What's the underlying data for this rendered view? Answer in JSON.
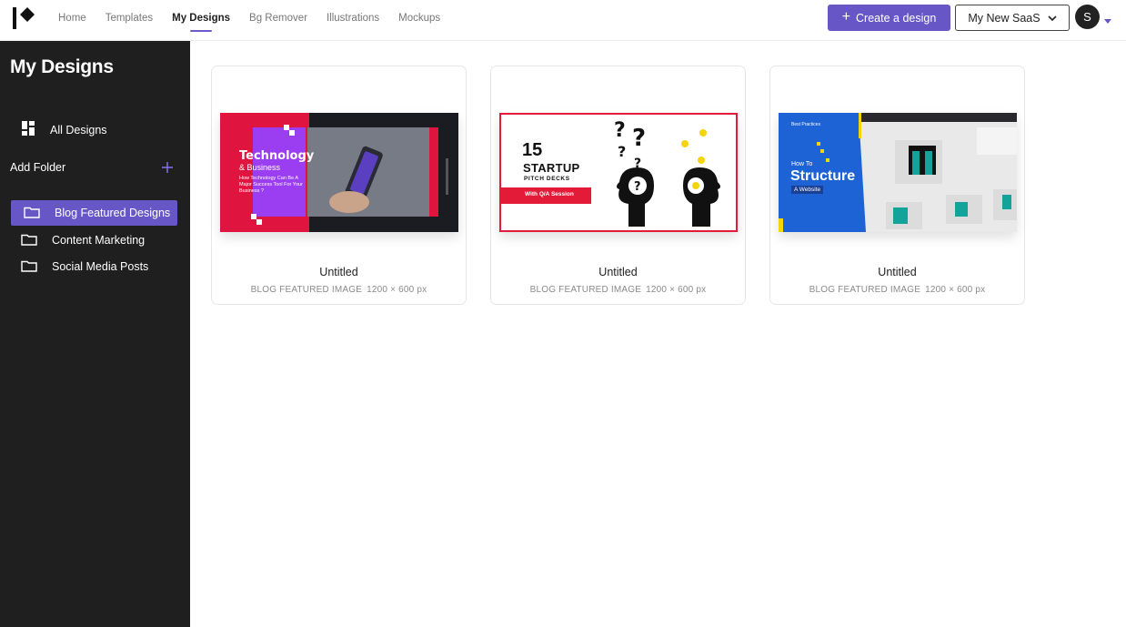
{
  "topbar": {
    "nav": [
      {
        "label": "Home",
        "active": false
      },
      {
        "label": "Templates",
        "active": false
      },
      {
        "label": "My Designs",
        "active": true
      },
      {
        "label": "Bg Remover",
        "active": false
      },
      {
        "label": "Illustrations",
        "active": false
      },
      {
        "label": "Mockups",
        "active": false
      }
    ],
    "create_label": "Create a design",
    "workspace_label": "My New SaaS",
    "avatar_initial": "S"
  },
  "sidebar": {
    "title": "My Designs",
    "all_designs_label": "All Designs",
    "add_folder_label": "Add Folder",
    "folders": [
      {
        "label": "Blog Featured Designs",
        "active": true
      },
      {
        "label": "Content Marketing",
        "active": false
      },
      {
        "label": "Social Media Posts",
        "active": false
      }
    ]
  },
  "designs": [
    {
      "title": "Untitled",
      "type": "BLOG FEATURED IMAGE",
      "size": "1200 × 600 px",
      "thumb": {
        "heading": "Technology",
        "subheading": "& Business",
        "body": "How Technology Can Be A Major Success Tool For Your Business ?"
      }
    },
    {
      "title": "Untitled",
      "type": "BLOG FEATURED IMAGE",
      "size": "1200 × 600 px",
      "thumb": {
        "number": "15",
        "heading": "STARTUP",
        "subheading": "PITCH DECKS",
        "badge": "With Q/A Session"
      }
    },
    {
      "title": "Untitled",
      "type": "BLOG FEATURED IMAGE",
      "size": "1200 × 600 px",
      "thumb": {
        "kicker": "Best Practices",
        "pre": "How To",
        "heading": "Structure",
        "subheading": "A Website"
      }
    }
  ],
  "colors": {
    "accent": "#6757c6",
    "sidebar_bg": "#1f1f1f",
    "thumb1_red": "#e0153f",
    "thumb1_purple": "#9b3df0",
    "thumb2_red": "#e31b38",
    "thumb3_blue": "#1e63d6"
  }
}
